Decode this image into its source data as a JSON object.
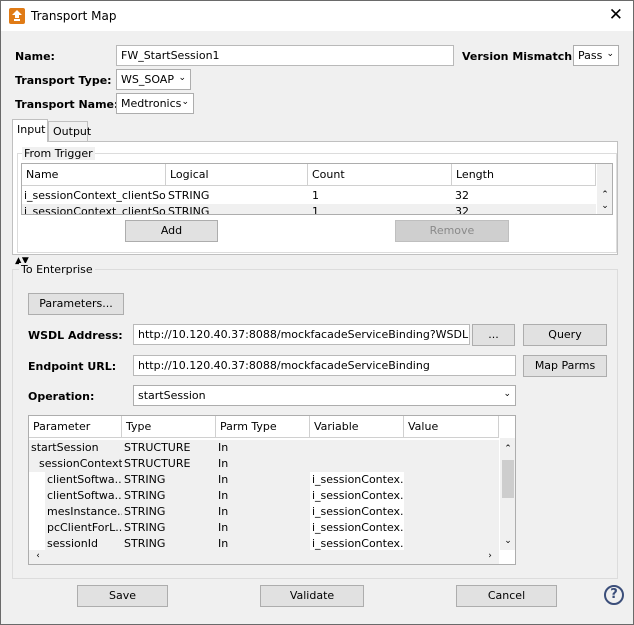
{
  "window": {
    "title": "Transport Map",
    "close_glyph": "✕"
  },
  "form": {
    "name_label": "Name:",
    "name_value": "FW_StartSession1",
    "version_mismatch_label": "Version Mismatch:",
    "version_mismatch_value": "Pass",
    "transport_type_label": "Transport Type:",
    "transport_type_value": "WS_SOAP",
    "transport_name_label": "Transport Name:",
    "transport_name_value": "Medtronics"
  },
  "tabs": [
    {
      "label": "Input"
    },
    {
      "label": "Output"
    }
  ],
  "from_trigger": {
    "title": "From Trigger",
    "columns": [
      "Name",
      "Logical",
      "Count",
      "Length"
    ],
    "rows": [
      [
        "i_sessionContext_clientSof...",
        "STRING",
        "1",
        "32"
      ],
      [
        "i_sessionContext_clientSof...",
        "STRING",
        "1",
        "32"
      ]
    ],
    "add_label": "Add",
    "remove_label": "Remove"
  },
  "to_enterprise": {
    "title": "To Enterprise",
    "parameters_label": "Parameters...",
    "wsdl_label": "WSDL Address:",
    "wsdl_value": "http://10.120.40.37:8088/mockfacadeServiceBinding?WSDL",
    "browse_label": "...",
    "query_label": "Query",
    "endpoint_label": "Endpoint URL:",
    "endpoint_value": "http://10.120.40.37:8088/mockfacadeServiceBinding",
    "map_parms_label": "Map Parms",
    "operation_label": "Operation:",
    "operation_value": "startSession",
    "columns": [
      "Parameter",
      "Type",
      "Parm Type",
      "Variable",
      "Value"
    ],
    "rows": [
      [
        "startSession",
        "STRUCTURE",
        "In",
        "",
        ""
      ],
      [
        "sessionContext",
        "STRUCTURE",
        "In",
        "",
        ""
      ],
      [
        "clientSoftwa...",
        "STRING",
        "In",
        "i_sessionContex...",
        ""
      ],
      [
        "clientSoftwa...",
        "STRING",
        "In",
        "i_sessionContex...",
        ""
      ],
      [
        "mesInstance...",
        "STRING",
        "In",
        "i_sessionContex...",
        ""
      ],
      [
        "pcClientForL...",
        "STRING",
        "In",
        "i_sessionContex...",
        ""
      ],
      [
        "sessionId",
        "STRING",
        "In",
        "i_sessionContex...",
        ""
      ]
    ]
  },
  "footer": {
    "save_label": "Save",
    "validate_label": "Validate",
    "cancel_label": "Cancel",
    "help_glyph": "?"
  },
  "colors": {
    "accent_icon": "#e07b16",
    "help": "#3b4e7a",
    "stripe": "#f0f0f0"
  }
}
